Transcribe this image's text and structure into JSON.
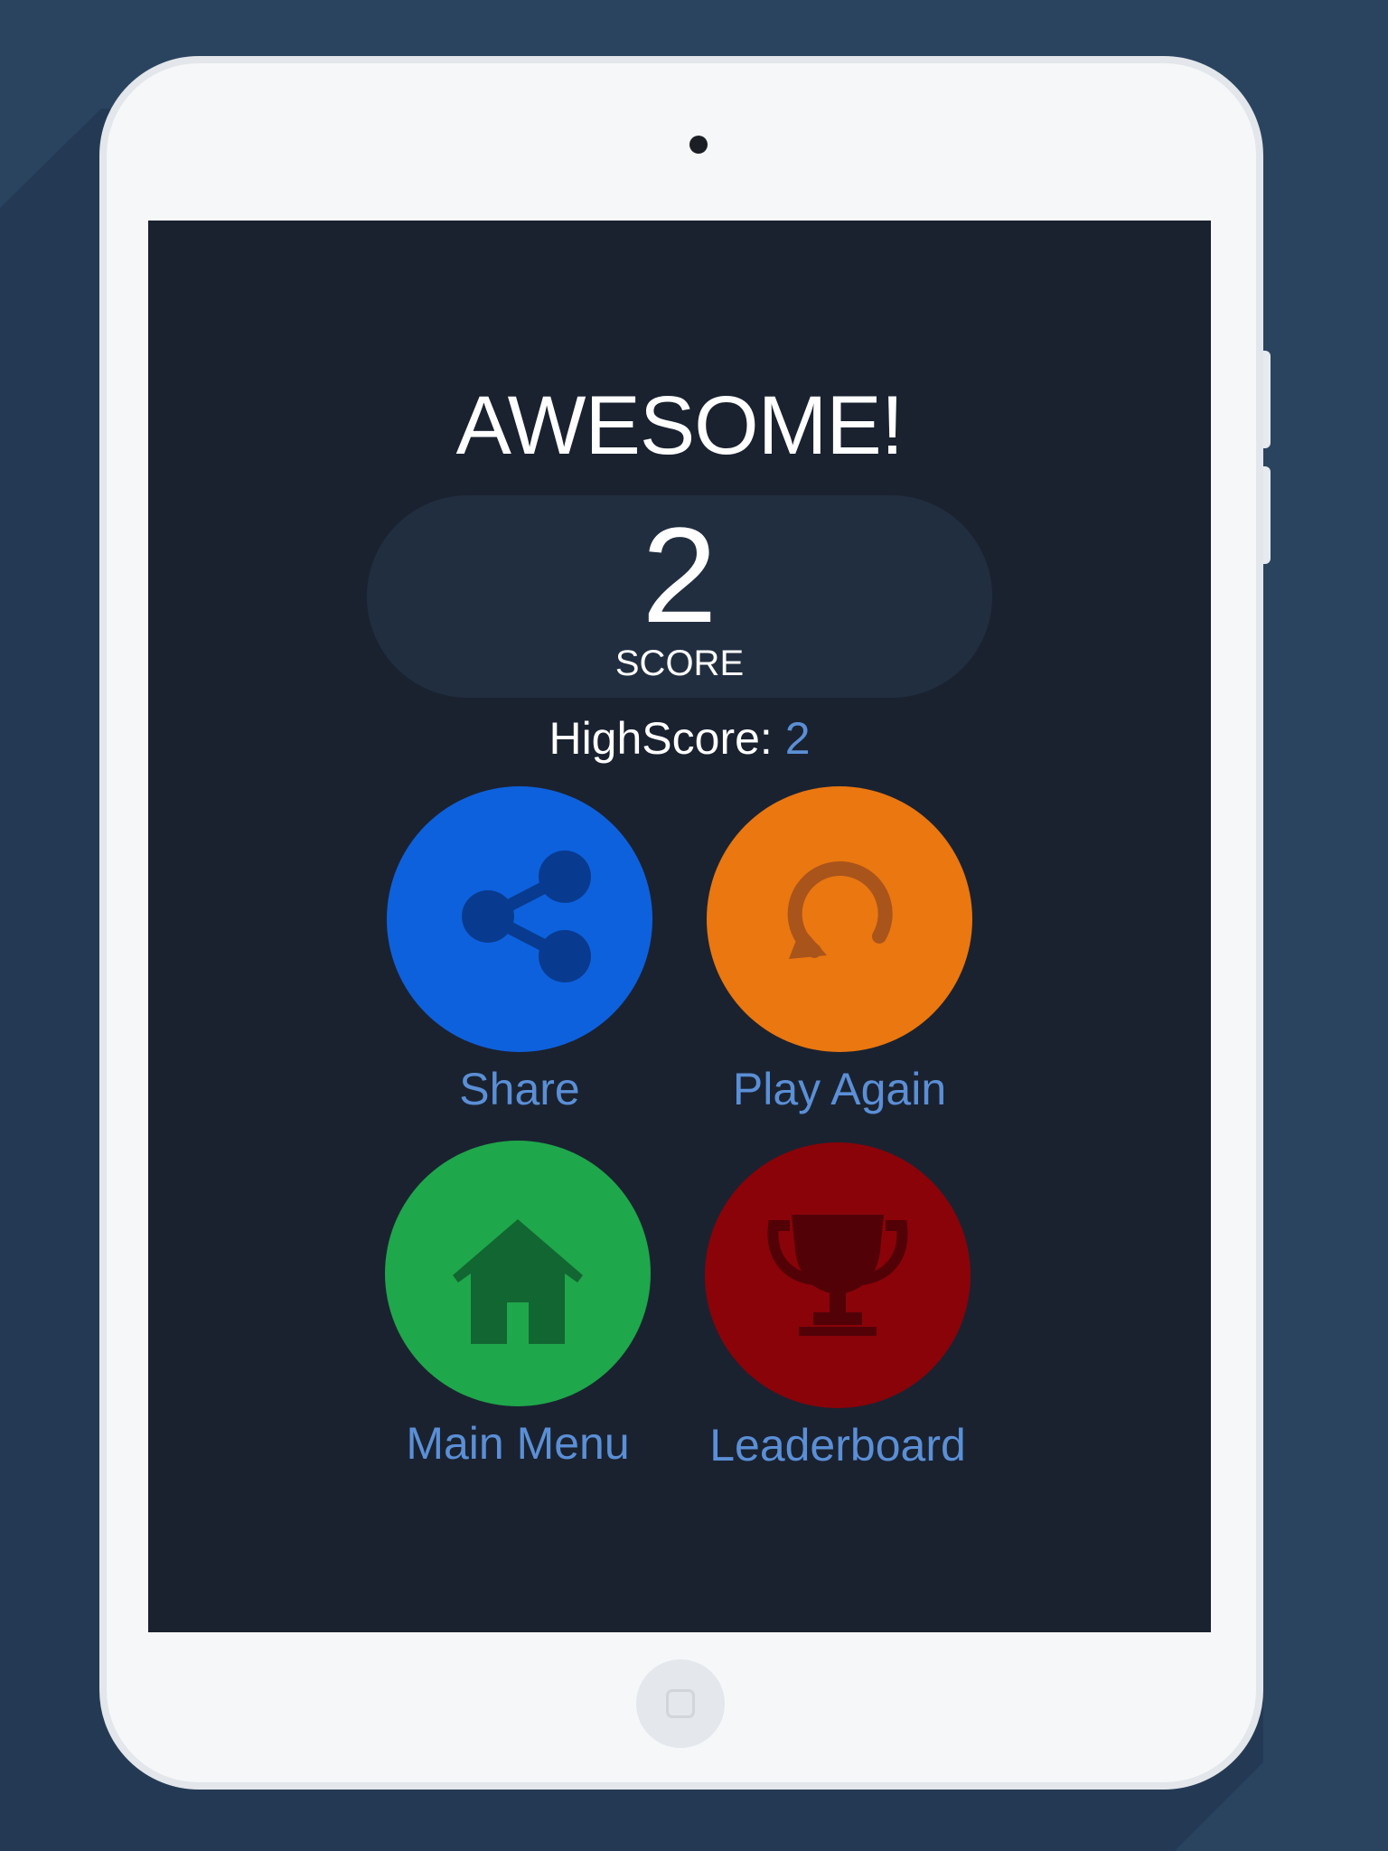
{
  "game": {
    "title": "AWESOME!",
    "score_value": "2",
    "score_label": "SCORE",
    "highscore_label": "HighScore:",
    "highscore_value": "2"
  },
  "actions": [
    {
      "label": "Share",
      "color": "#0e61dd",
      "icon": "share-icon",
      "icon_color": "#083b8f"
    },
    {
      "label": "Play Again",
      "color": "#ea7710",
      "icon": "replay-icon",
      "icon_color": "#a9541b"
    },
    {
      "label": "Main Menu",
      "color": "#1fa74b",
      "icon": "home-icon",
      "icon_color": "#126631"
    },
    {
      "label": "Leaderboard",
      "color": "#8a0309",
      "icon": "trophy-icon",
      "icon_color": "#520207"
    }
  ],
  "colors": {
    "background": "#2a4460",
    "screen": "#1a2230",
    "score_pill": "#212e40",
    "accent_text": "#5b8fd6",
    "device_body": "#f5f7f9"
  }
}
